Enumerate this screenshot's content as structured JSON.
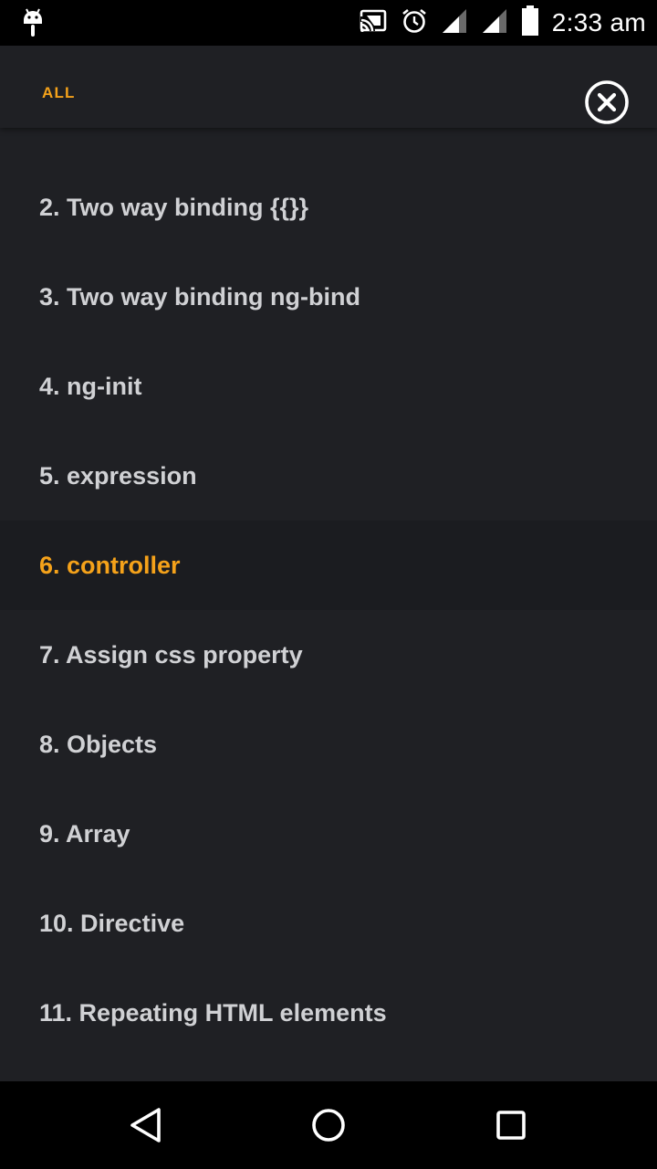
{
  "status_bar": {
    "time": "2:33 am",
    "icons": [
      "android-debug-icon",
      "cast-icon",
      "alarm-icon",
      "signal-icon",
      "signal-icon",
      "battery-icon"
    ]
  },
  "header": {
    "filter_label": "ALL",
    "close_icon": "close-circle-icon"
  },
  "list": {
    "items": [
      {
        "label": "2. Two way binding {{}}",
        "active": false
      },
      {
        "label": "3. Two way binding ng-bind",
        "active": false
      },
      {
        "label": "4. ng-init",
        "active": false
      },
      {
        "label": "5. expression",
        "active": false
      },
      {
        "label": "6. controller",
        "active": true
      },
      {
        "label": "7. Assign css property",
        "active": false
      },
      {
        "label": "8. Objects",
        "active": false
      },
      {
        "label": "9. Array",
        "active": false
      },
      {
        "label": "10. Directive",
        "active": false
      },
      {
        "label": "11. Repeating HTML elements",
        "active": false
      }
    ]
  },
  "nav_bar": {
    "buttons": [
      "back-icon",
      "home-icon",
      "recents-icon"
    ]
  },
  "colors": {
    "accent": "#f5a21a",
    "background": "#1f2024",
    "active_row": "#1b1c20",
    "text": "#d0d1d4"
  }
}
